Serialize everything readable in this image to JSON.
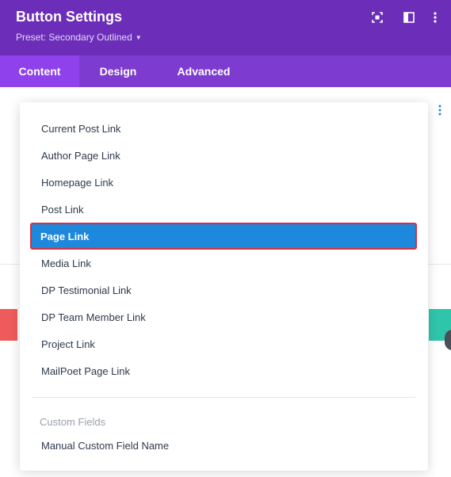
{
  "header": {
    "title": "Button Settings",
    "preset_label": "Preset: Secondary Outlined",
    "icons": [
      "expand-icon",
      "sidebar-icon",
      "more-vert-icon"
    ]
  },
  "tabs": [
    {
      "label": "Content",
      "active": true
    },
    {
      "label": "Design",
      "active": false
    },
    {
      "label": "Advanced",
      "active": false
    }
  ],
  "dropdown": {
    "items": [
      {
        "label": "Current Post Link",
        "selected": false
      },
      {
        "label": "Author Page Link",
        "selected": false
      },
      {
        "label": "Homepage Link",
        "selected": false
      },
      {
        "label": "Post Link",
        "selected": false
      },
      {
        "label": "Page Link",
        "selected": true
      },
      {
        "label": "Media Link",
        "selected": false
      },
      {
        "label": "DP Testimonial Link",
        "selected": false
      },
      {
        "label": "DP Team Member Link",
        "selected": false
      },
      {
        "label": "Project Link",
        "selected": false
      },
      {
        "label": "MailPoet Page Link",
        "selected": false
      }
    ],
    "group_label": "Custom Fields",
    "group_items": [
      {
        "label": "Manual Custom Field Name"
      }
    ]
  },
  "colors": {
    "header_bg": "#6c2eb9",
    "tabs_bg": "#7e3bd0",
    "active_tab_bg": "#8f42ec",
    "selected_item_bg": "#1e88dd",
    "selected_item_border": "#d6313f",
    "accent_red": "#ef5b5b",
    "accent_teal": "#2fc5ab"
  }
}
